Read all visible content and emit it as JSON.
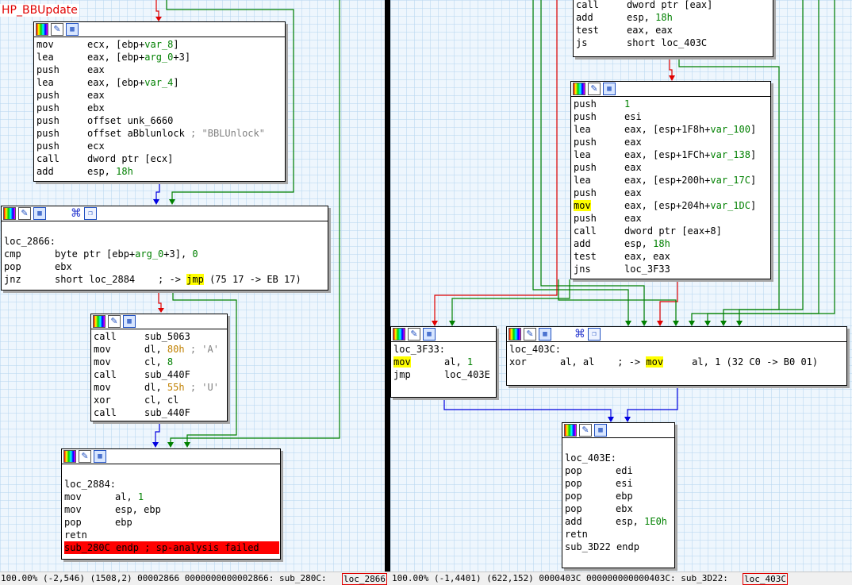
{
  "left_view": {
    "function_label": "HP_BBUpdate",
    "blocks": {
      "b1": [
        [
          "mov",
          "ecx, [ebp+",
          {
            "t": "var_8",
            "c": "g"
          },
          "]"
        ],
        [
          "lea",
          "eax, [ebp+",
          {
            "t": "arg_0",
            "c": "g"
          },
          "+3]"
        ],
        [
          "push",
          "eax"
        ],
        [
          "lea",
          "eax, [ebp+",
          {
            "t": "var_4",
            "c": "g"
          },
          "]"
        ],
        [
          "push",
          "eax"
        ],
        [
          "push",
          "ebx"
        ],
        [
          "push",
          "offset unk_6660"
        ],
        [
          "push",
          "offset aBblunlock ",
          {
            "t": "; \"BBLUnlock\"",
            "c": "gr"
          }
        ],
        [
          "push",
          "ecx"
        ],
        [
          "call",
          "dword ptr [ecx]"
        ],
        [
          "add",
          "esp, ",
          {
            "t": "18h",
            "c": "g"
          }
        ]
      ],
      "b2": [
        null,
        {
          "label": "loc_2866:"
        },
        [
          "cmp",
          "byte ptr [ebp+",
          {
            "t": "arg_0",
            "c": "g"
          },
          "+3], ",
          {
            "t": "0",
            "c": "g"
          }
        ],
        [
          "pop",
          "ebx"
        ],
        [
          "jnz",
          "short loc_2884    ; -> ",
          {
            "t": "jmp",
            "c": "hl"
          },
          " (75 17 -> EB 17)"
        ]
      ],
      "b3": [
        [
          "call",
          "sub_5063"
        ],
        [
          "mov",
          "dl, ",
          {
            "t": "80h",
            "c": "o"
          },
          {
            "t": " ; 'A'",
            "c": "gr"
          }
        ],
        [
          "mov",
          "cl, ",
          {
            "t": "8",
            "c": "g"
          }
        ],
        [
          "call",
          "sub_440F"
        ],
        [
          "mov",
          "dl, ",
          {
            "t": "55h",
            "c": "o"
          },
          {
            "t": " ; 'U'",
            "c": "gr"
          }
        ],
        [
          "xor",
          "cl, cl"
        ],
        [
          "call",
          "sub_440F"
        ]
      ],
      "b4": [
        null,
        {
          "label": "loc_2884:"
        },
        [
          "mov",
          "al, ",
          {
            "t": "1",
            "c": "g"
          }
        ],
        [
          "mov",
          "esp, ebp"
        ],
        [
          "pop",
          "ebp"
        ],
        [
          "retn",
          ""
        ],
        {
          "error": "sub_280C endp ; sp-analysis failed"
        }
      ]
    }
  },
  "right_view": {
    "blocks": {
      "r1": [
        [
          "call",
          "dword ptr [eax]"
        ],
        [
          "add",
          "esp, ",
          {
            "t": "18h",
            "c": "g"
          }
        ],
        [
          "test",
          "eax, eax"
        ],
        [
          "js",
          "short loc_403C"
        ]
      ],
      "r2": [
        [
          "push",
          {
            "t": "1",
            "c": "g"
          }
        ],
        [
          "push",
          "esi"
        ],
        [
          "lea",
          "eax, [esp+1F8h+",
          {
            "t": "var_100",
            "c": "g"
          },
          "]"
        ],
        [
          "push",
          "eax"
        ],
        [
          "lea",
          "eax, [esp+1FCh+",
          {
            "t": "var_138",
            "c": "g"
          },
          "]"
        ],
        [
          "push",
          "eax"
        ],
        [
          "lea",
          "eax, [esp+200h+",
          {
            "t": "var_17C",
            "c": "g"
          },
          "]"
        ],
        [
          "push",
          "eax"
        ],
        [
          {
            "t": "mov",
            "c": "hl"
          },
          "eax, [esp+204h+",
          {
            "t": "var_1DC",
            "c": "g"
          },
          "]"
        ],
        [
          "push",
          "eax"
        ],
        [
          "call",
          "dword ptr [eax+8]"
        ],
        [
          "add",
          "esp, ",
          {
            "t": "18h",
            "c": "g"
          }
        ],
        [
          "test",
          "eax, eax"
        ],
        [
          "jns",
          "loc_3F33"
        ]
      ],
      "r3": [
        {
          "label": "loc_3F33:"
        },
        [
          {
            "t": "mov",
            "c": "hl"
          },
          "al, ",
          {
            "t": "1",
            "c": "g"
          }
        ],
        [
          "jmp",
          "loc_403E"
        ]
      ],
      "r4": [
        {
          "label": "loc_403C:"
        },
        [
          "xor",
          "al, al    ; -> ",
          {
            "t": "mov",
            "c": "hl"
          },
          "     al, 1 (32 C0 -> B0 01)"
        ]
      ],
      "r5": [
        null,
        {
          "label": "loc_403E:"
        },
        [
          "pop",
          "edi"
        ],
        [
          "pop",
          "esi"
        ],
        [
          "pop",
          "ebp"
        ],
        [
          "pop",
          "ebx"
        ],
        [
          "add",
          "esp, ",
          {
            "t": "1E0h",
            "c": "g"
          }
        ],
        [
          "retn",
          ""
        ],
        {
          "label": "sub_3D22 endp"
        }
      ]
    }
  },
  "statusbar": {
    "left_text": "100.00% (-2,546) (1508,2) 00002866 0000000000002866: sub_280C:",
    "left_loc": "loc_2866",
    "right_text": "100.00% (-1,4401) (622,152) 0000403C 000000000000403C: sub_3D22:",
    "right_loc": "loc_403C"
  },
  "edge_colors": {
    "true": "#008000",
    "false": "#e00000",
    "unconditional": "#0000e0"
  }
}
